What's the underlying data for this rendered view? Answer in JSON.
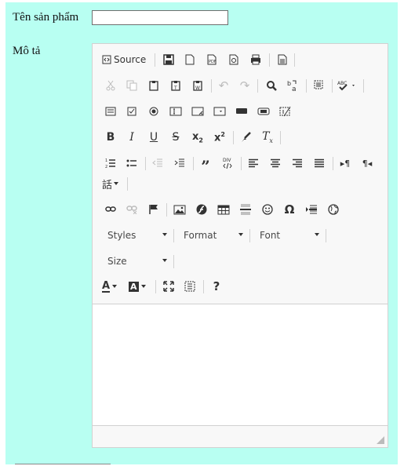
{
  "form": {
    "name_label": "Tên sản phẩm",
    "name_value": "",
    "desc_label": "Mô tả"
  },
  "editor": {
    "source_label": "Source",
    "styles_label": "Styles",
    "format_label": "Format",
    "font_label": "Font",
    "size_label": "Size",
    "content": ""
  },
  "colors": {
    "panel_bg": "#b8fff2",
    "toolbar_bg": "#f8f8f8",
    "border": "#d1d1d1"
  }
}
